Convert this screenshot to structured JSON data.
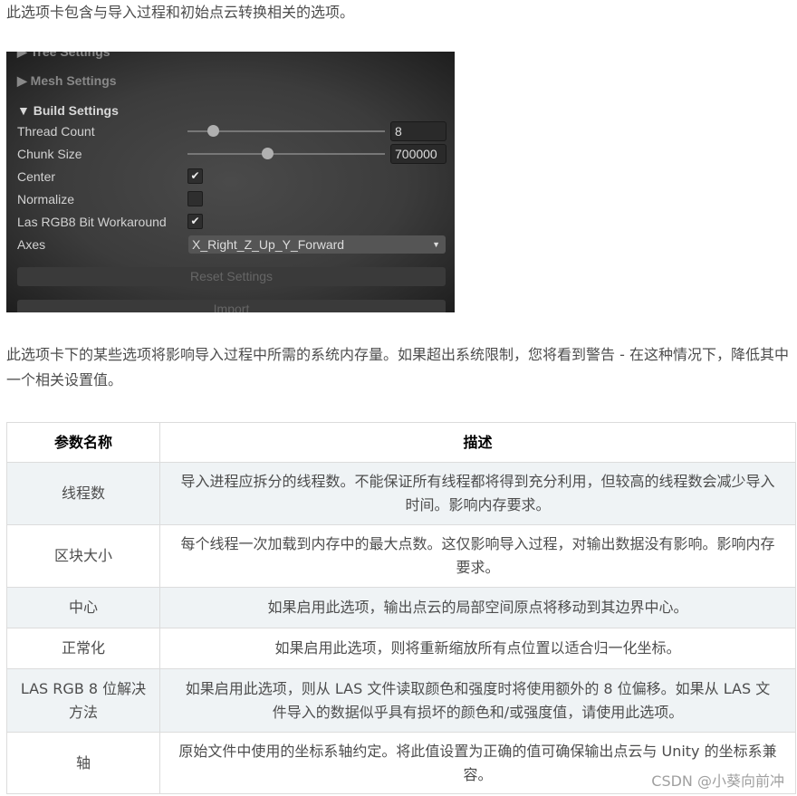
{
  "intro": "此选项卡包含与导入过程和初始点云转换相关的选项。",
  "panel": {
    "tree_settings": "Tree Settings",
    "mesh_settings": "Mesh Settings",
    "build_settings": "Build Settings",
    "thread_count": {
      "label": "Thread Count",
      "value": "8",
      "slider_fraction": 0.14
    },
    "chunk_size": {
      "label": "Chunk Size",
      "value": "700000",
      "slider_fraction": 0.41
    },
    "center": {
      "label": "Center",
      "checked": true,
      "mark": "✔"
    },
    "normalize": {
      "label": "Normalize",
      "checked": false
    },
    "las_rgb8": {
      "label": "Las RGB8 Bit Workaround",
      "checked": true,
      "mark": "✔"
    },
    "axes": {
      "label": "Axes",
      "value": "X_Right_Z_Up_Y_Forward"
    },
    "reset_button": "Reset Settings",
    "import_button": "Import"
  },
  "note": "此选项卡下的某些选项将影响导入过程中所需的系统内存量。如果超出系统限制，您将看到警告 - 在这种情况下，降低其中一个相关设置值。",
  "table": {
    "headers": [
      "参数名称",
      "描述"
    ],
    "rows": [
      [
        "线程数",
        "导入进程应拆分的线程数。不能保证所有线程都将得到充分利用，但较高的线程数会减少导入时间。影响内存要求。"
      ],
      [
        "区块大小",
        "每个线程一次加载到内存中的最大点数。这仅影响导入过程，对输出数据没有影响。影响内存要求。"
      ],
      [
        "中心",
        "如果启用此选项，输出点云的局部空间原点将移动到其边界中心。"
      ],
      [
        "正常化",
        "如果启用此选项，则将重新缩放所有点位置以适合归一化坐标。"
      ],
      [
        "LAS RGB 8 位解决方法",
        "如果启用此选项，则从 LAS 文件读取颜色和强度时将使用额外的 8 位偏移。如果从 LAS 文件导入的数据似乎具有损坏的颜色和/或强度值，请使用此选项。"
      ],
      [
        "轴",
        "原始文件中使用的坐标系轴约定。将此值设置为正确的值可确保输出点云与 Unity 的坐标系兼容。"
      ]
    ]
  },
  "watermark": "CSDN @小葵向前冲"
}
